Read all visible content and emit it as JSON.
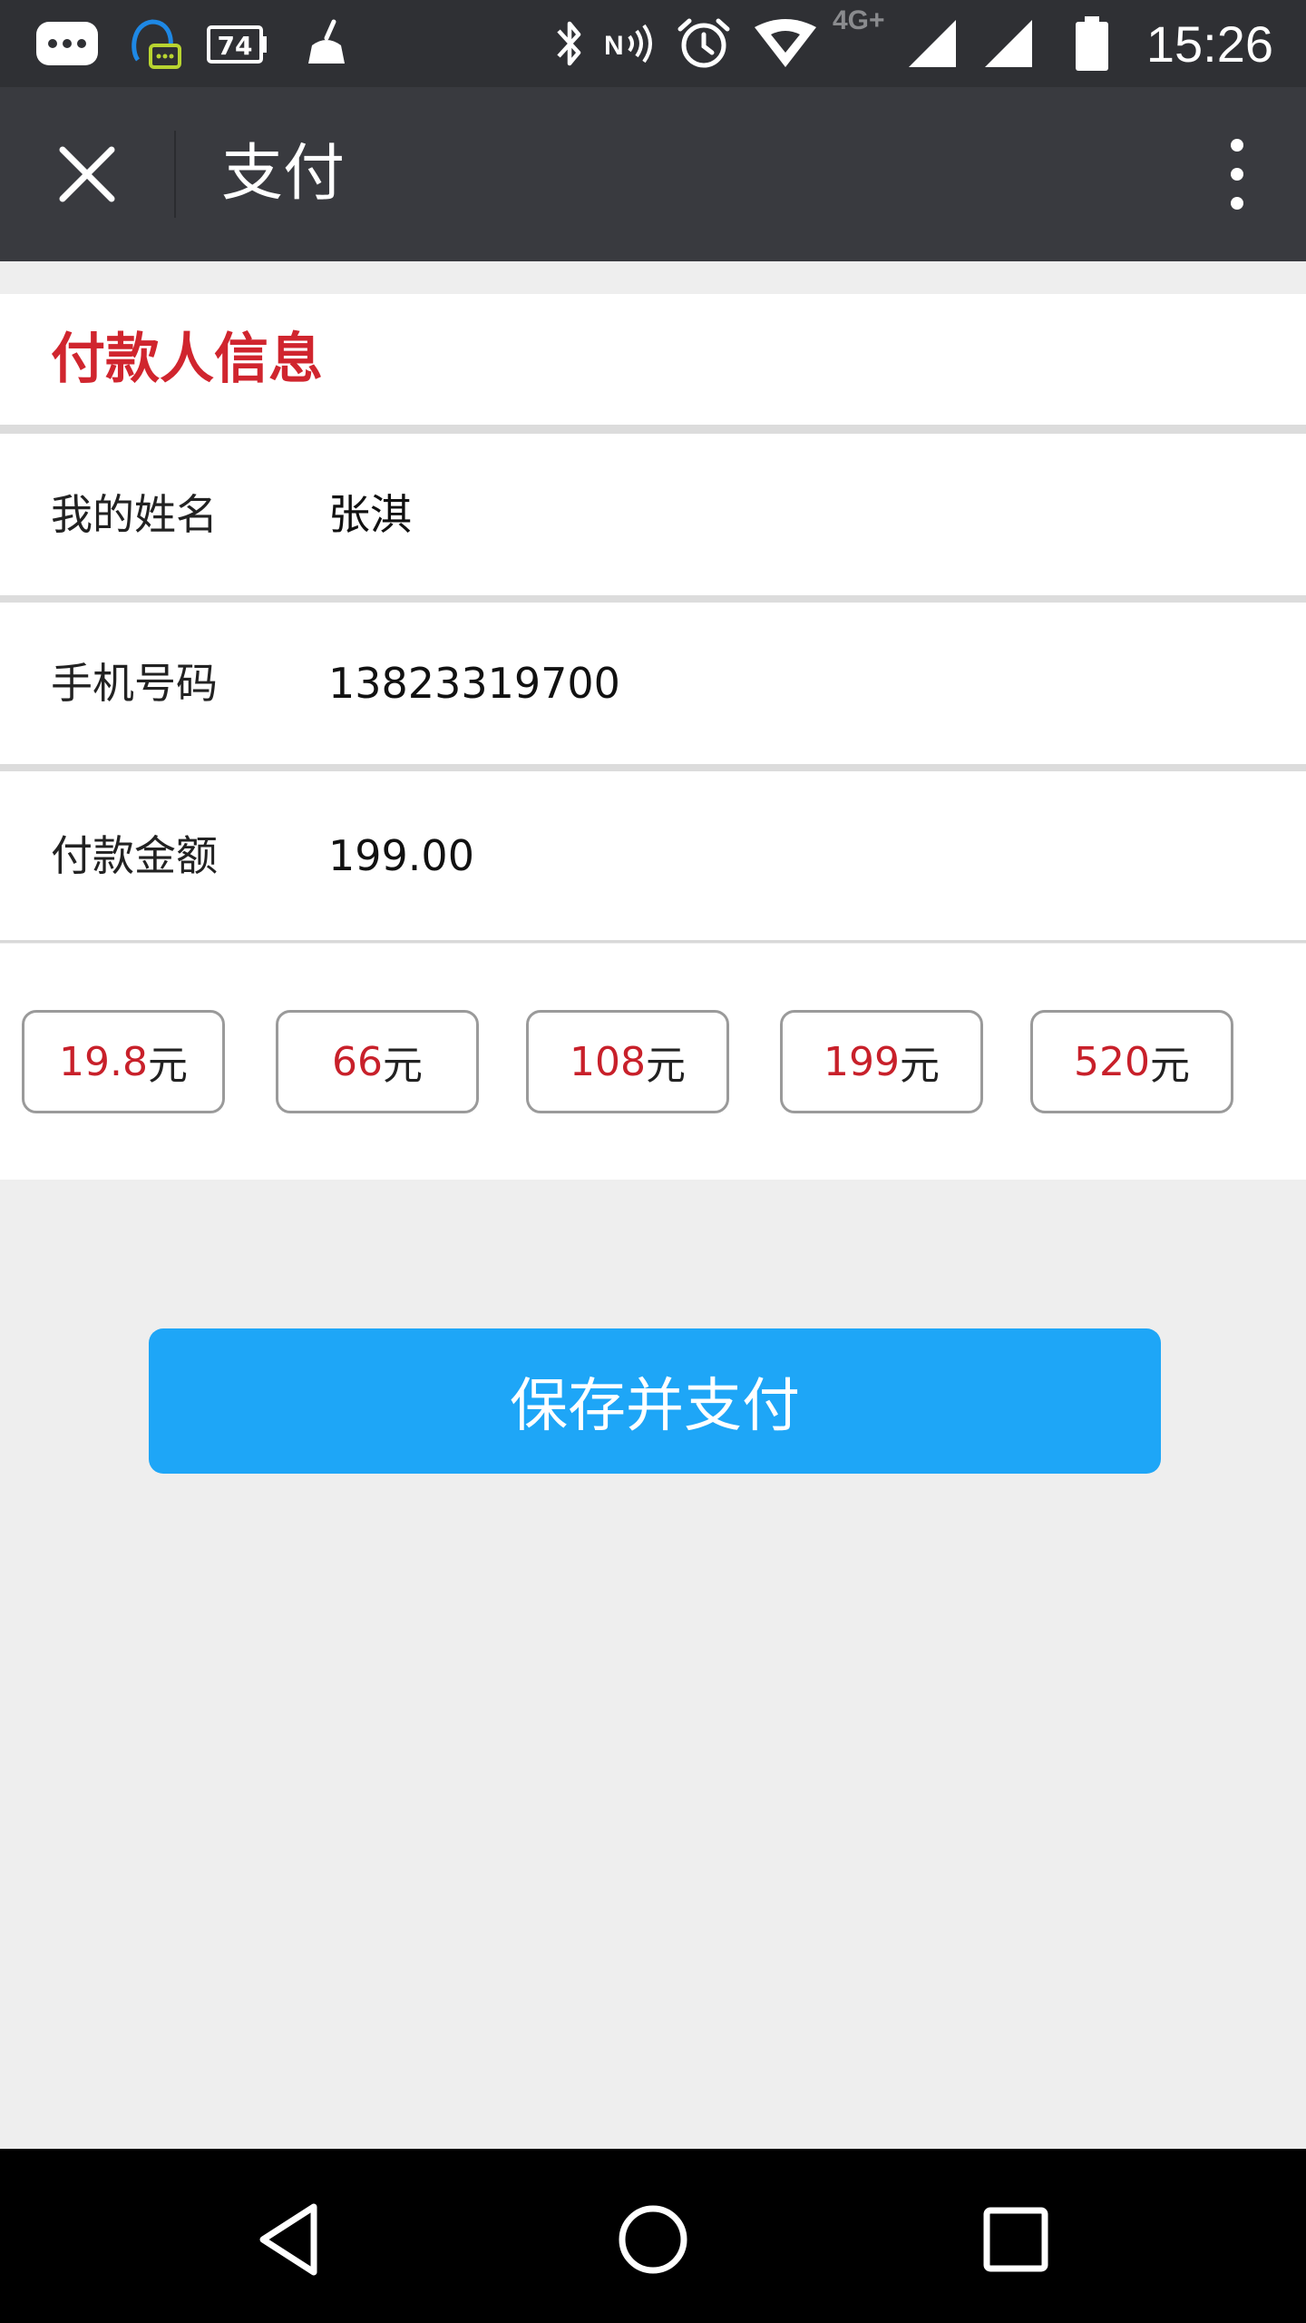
{
  "status_bar": {
    "time": "15:26",
    "network_label": "4G+",
    "battery_notification": "74",
    "icons": [
      "message-notification-icon",
      "qq-icon",
      "battery-74-icon",
      "cleaner-icon",
      "bluetooth-icon",
      "nfc-icon",
      "alarm-icon",
      "wifi-icon",
      "signal-icon",
      "signal-icon",
      "battery-icon"
    ]
  },
  "title_bar": {
    "title": "支付",
    "close_icon": "close-icon",
    "more_icon": "more-vertical-icon"
  },
  "section": {
    "title": "付款人信息"
  },
  "form": {
    "name_label": "我的姓名",
    "name_value": "张淇",
    "phone_label": "手机号码",
    "phone_value": "13823319700",
    "amount_label": "付款金额",
    "amount_value": "199.00"
  },
  "amount_options": [
    {
      "number": "19.8",
      "unit": "元"
    },
    {
      "number": "66",
      "unit": "元"
    },
    {
      "number": "108",
      "unit": "元"
    },
    {
      "number": "199",
      "unit": "元"
    },
    {
      "number": "520",
      "unit": "元"
    }
  ],
  "pay_button": {
    "label": "保存并支付"
  },
  "colors": {
    "accent_red": "#d0252e",
    "button_blue": "#1ea6f7",
    "title_bar": "#393a3f",
    "status_bar": "#2f3034"
  },
  "nav_bar": {
    "icons": [
      "back-icon",
      "home-icon",
      "recents-icon"
    ]
  }
}
